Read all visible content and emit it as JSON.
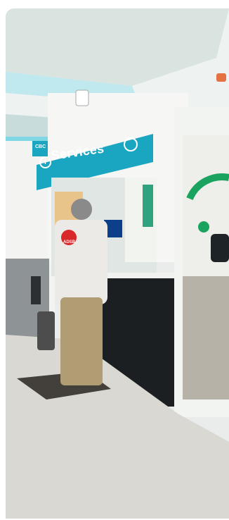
{
  "sign": {
    "label": "Services",
    "info_icon": "info-icon"
  },
  "vest": {
    "label": "ADSB"
  },
  "side_sign": {
    "label": "CBC"
  }
}
